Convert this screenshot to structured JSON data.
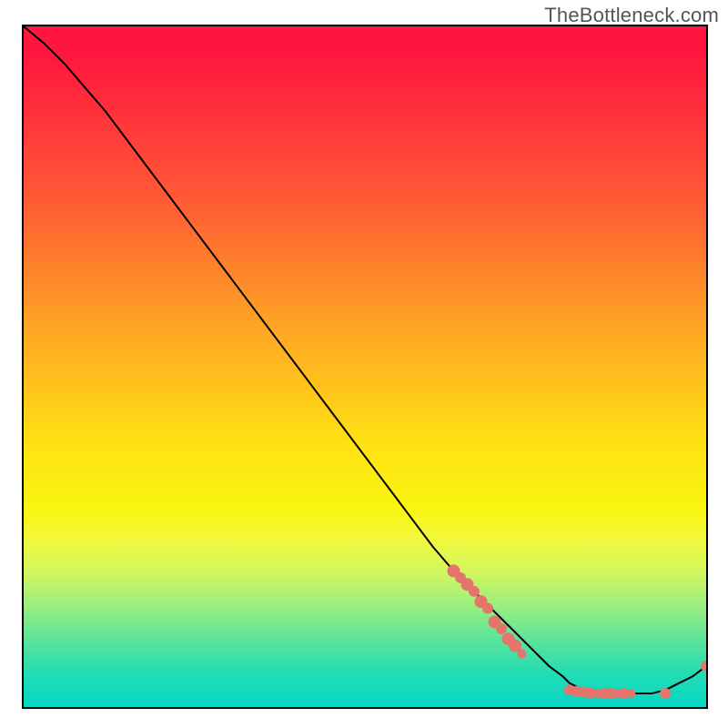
{
  "watermark": "TheBottleneck.com",
  "chart_data": {
    "type": "line",
    "title": "",
    "xlabel": "",
    "ylabel": "",
    "xlim": [
      0,
      100
    ],
    "ylim": [
      0,
      100
    ],
    "grid": false,
    "legend": false,
    "background": "rainbow-gradient-red-to-teal",
    "series": [
      {
        "name": "curve",
        "color": "#000000",
        "x": [
          0,
          3,
          6,
          9,
          12,
          15,
          18,
          21,
          24,
          27,
          30,
          33,
          36,
          39,
          42,
          45,
          48,
          51,
          54,
          57,
          60,
          63,
          65,
          67,
          69,
          71,
          73,
          75,
          77,
          79,
          80,
          82,
          84,
          86,
          88,
          90,
          92,
          94,
          96,
          98,
          100
        ],
        "y": [
          100,
          97.5,
          94.5,
          91,
          87.5,
          83.5,
          79.5,
          75.5,
          71.5,
          67.5,
          63.5,
          59.5,
          55.5,
          51.5,
          47.5,
          43.5,
          39.5,
          35.5,
          31.5,
          27.5,
          23.5,
          20,
          18,
          16,
          14,
          12,
          10,
          8,
          6,
          4.5,
          3.5,
          2.5,
          2,
          2,
          2,
          2,
          2,
          2.5,
          3.5,
          4.5,
          6
        ]
      }
    ],
    "points": [
      {
        "x": 63,
        "y": 20,
        "r": 7
      },
      {
        "x": 64,
        "y": 19,
        "r": 6
      },
      {
        "x": 65,
        "y": 18,
        "r": 7
      },
      {
        "x": 66,
        "y": 17,
        "r": 6
      },
      {
        "x": 67,
        "y": 15.5,
        "r": 7
      },
      {
        "x": 68,
        "y": 14.5,
        "r": 6
      },
      {
        "x": 69,
        "y": 12.5,
        "r": 7
      },
      {
        "x": 70,
        "y": 11.5,
        "r": 6
      },
      {
        "x": 71,
        "y": 10,
        "r": 7
      },
      {
        "x": 72,
        "y": 9,
        "r": 7
      },
      {
        "x": 73,
        "y": 7.8,
        "r": 5
      },
      {
        "x": 80,
        "y": 2.5,
        "r": 6
      },
      {
        "x": 81,
        "y": 2.3,
        "r": 6
      },
      {
        "x": 82,
        "y": 2.2,
        "r": 6
      },
      {
        "x": 83,
        "y": 2.1,
        "r": 6
      },
      {
        "x": 84,
        "y": 2.0,
        "r": 5
      },
      {
        "x": 85,
        "y": 2.0,
        "r": 6
      },
      {
        "x": 86,
        "y": 2.0,
        "r": 6
      },
      {
        "x": 87,
        "y": 2.0,
        "r": 5
      },
      {
        "x": 88,
        "y": 2.0,
        "r": 6
      },
      {
        "x": 89,
        "y": 2.0,
        "r": 5
      },
      {
        "x": 94,
        "y": 2.0,
        "r": 6
      },
      {
        "x": 100,
        "y": 6.0,
        "r": 6
      }
    ]
  }
}
